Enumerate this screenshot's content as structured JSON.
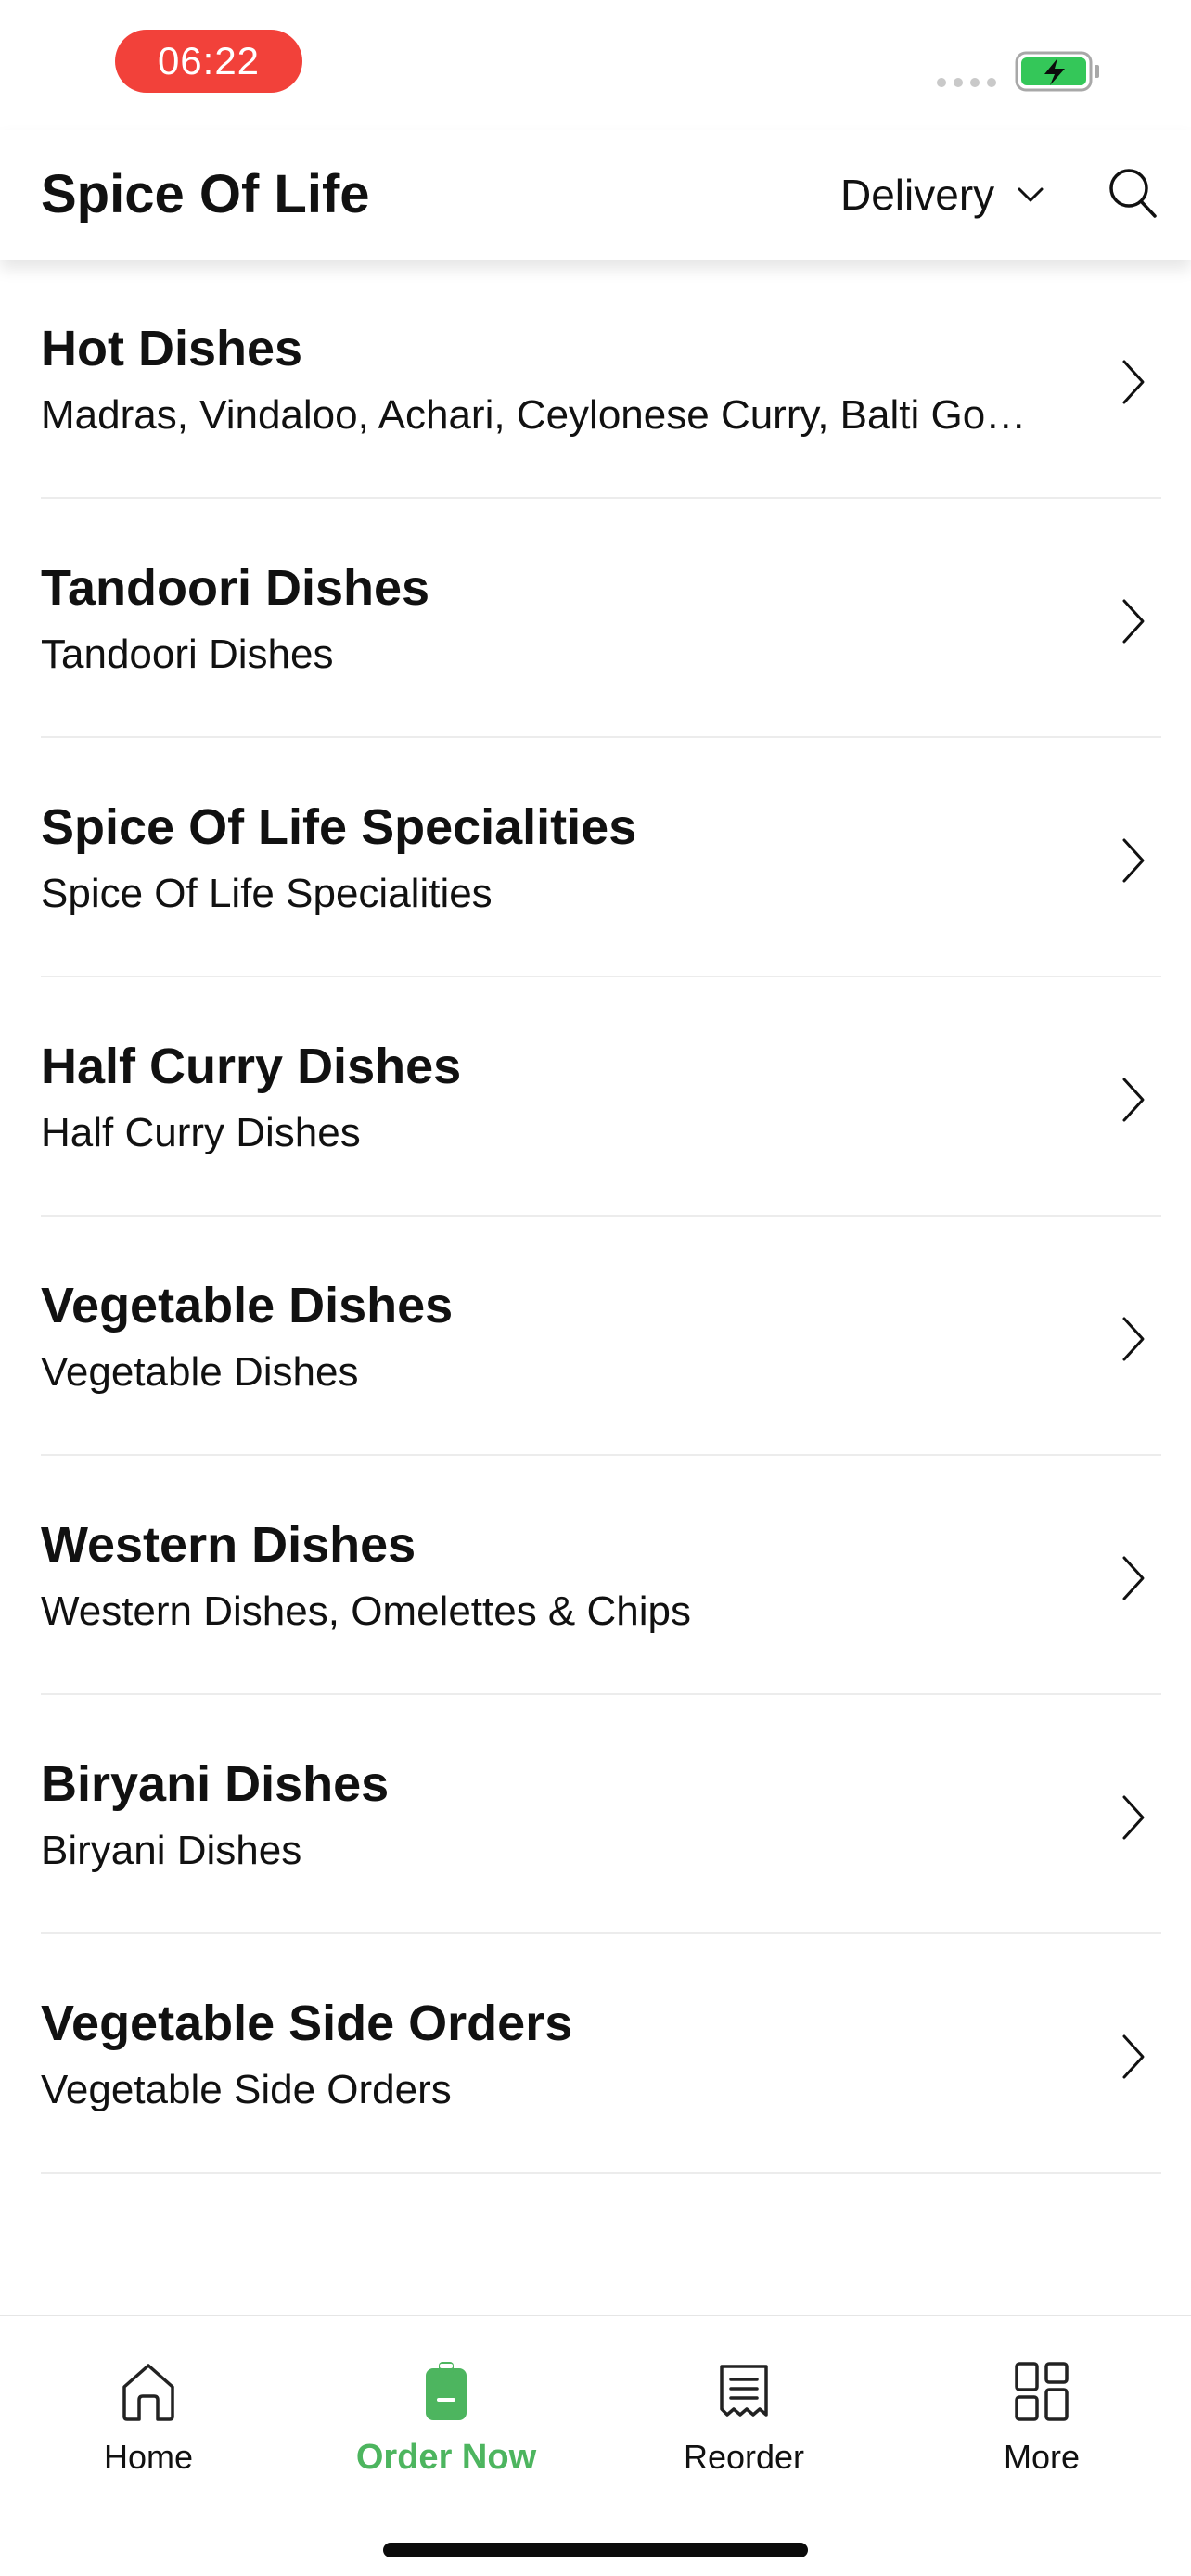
{
  "status_bar": {
    "time": "06:22",
    "time_pill_color": "#f2413a",
    "battery_state": "charging",
    "battery_color": "#34c759"
  },
  "header": {
    "title": "Spice Of Life",
    "delivery_label": "Delivery",
    "chevron_icon": "chevron-down-icon",
    "search_icon": "search-icon"
  },
  "categories": [
    {
      "title": "Hot Dishes",
      "subtitle": "Madras, Vindaloo, Achari, Ceylonese Curry, Balti Gosht, Jalfrezi"
    },
    {
      "title": "Tandoori Dishes",
      "subtitle": "Tandoori Dishes"
    },
    {
      "title": "Spice Of Life Specialities",
      "subtitle": "Spice Of Life Specialities"
    },
    {
      "title": "Half Curry Dishes",
      "subtitle": "Half Curry Dishes"
    },
    {
      "title": "Vegetable Dishes",
      "subtitle": "Vegetable Dishes"
    },
    {
      "title": "Western Dishes",
      "subtitle": "Western Dishes, Omelettes & Chips"
    },
    {
      "title": "Biryani Dishes",
      "subtitle": "Biryani Dishes"
    },
    {
      "title": "Vegetable Side Orders",
      "subtitle": "Vegetable Side Orders"
    }
  ],
  "bottom_nav": {
    "accent_color": "#4db55f",
    "items": [
      {
        "label": "Home",
        "icon": "home-icon",
        "active": false
      },
      {
        "label": "Order Now",
        "icon": "order-bag-icon",
        "active": true
      },
      {
        "label": "Reorder",
        "icon": "receipt-icon",
        "active": false
      },
      {
        "label": "More",
        "icon": "grid-icon",
        "active": false
      }
    ]
  }
}
